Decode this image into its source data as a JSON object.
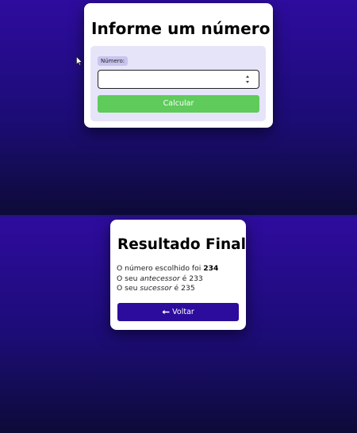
{
  "form": {
    "title": "Informe um número",
    "field_label": "Número:",
    "input_value": "",
    "submit_label": "Calcular"
  },
  "result": {
    "title": "Resultado Final",
    "chosen_prefix": "O número escolhido foi ",
    "chosen_value": "234",
    "predecessor_prefix": "O seu ",
    "predecessor_term": "antecessor",
    "predecessor_suffix": " é ",
    "predecessor_value": "233",
    "successor_prefix": "O seu ",
    "successor_term": "sucessor",
    "successor_suffix": " é ",
    "successor_value": "235",
    "back_arrow_icon": "left-arrow-icon",
    "back_label": "Voltar"
  },
  "colors": {
    "background_top": "#2e0c9e",
    "background_bottom": "#0d0b38",
    "calc_button": "#5ecb5a",
    "back_button": "#2c0c9c",
    "form_box": "#e6e4f9"
  }
}
